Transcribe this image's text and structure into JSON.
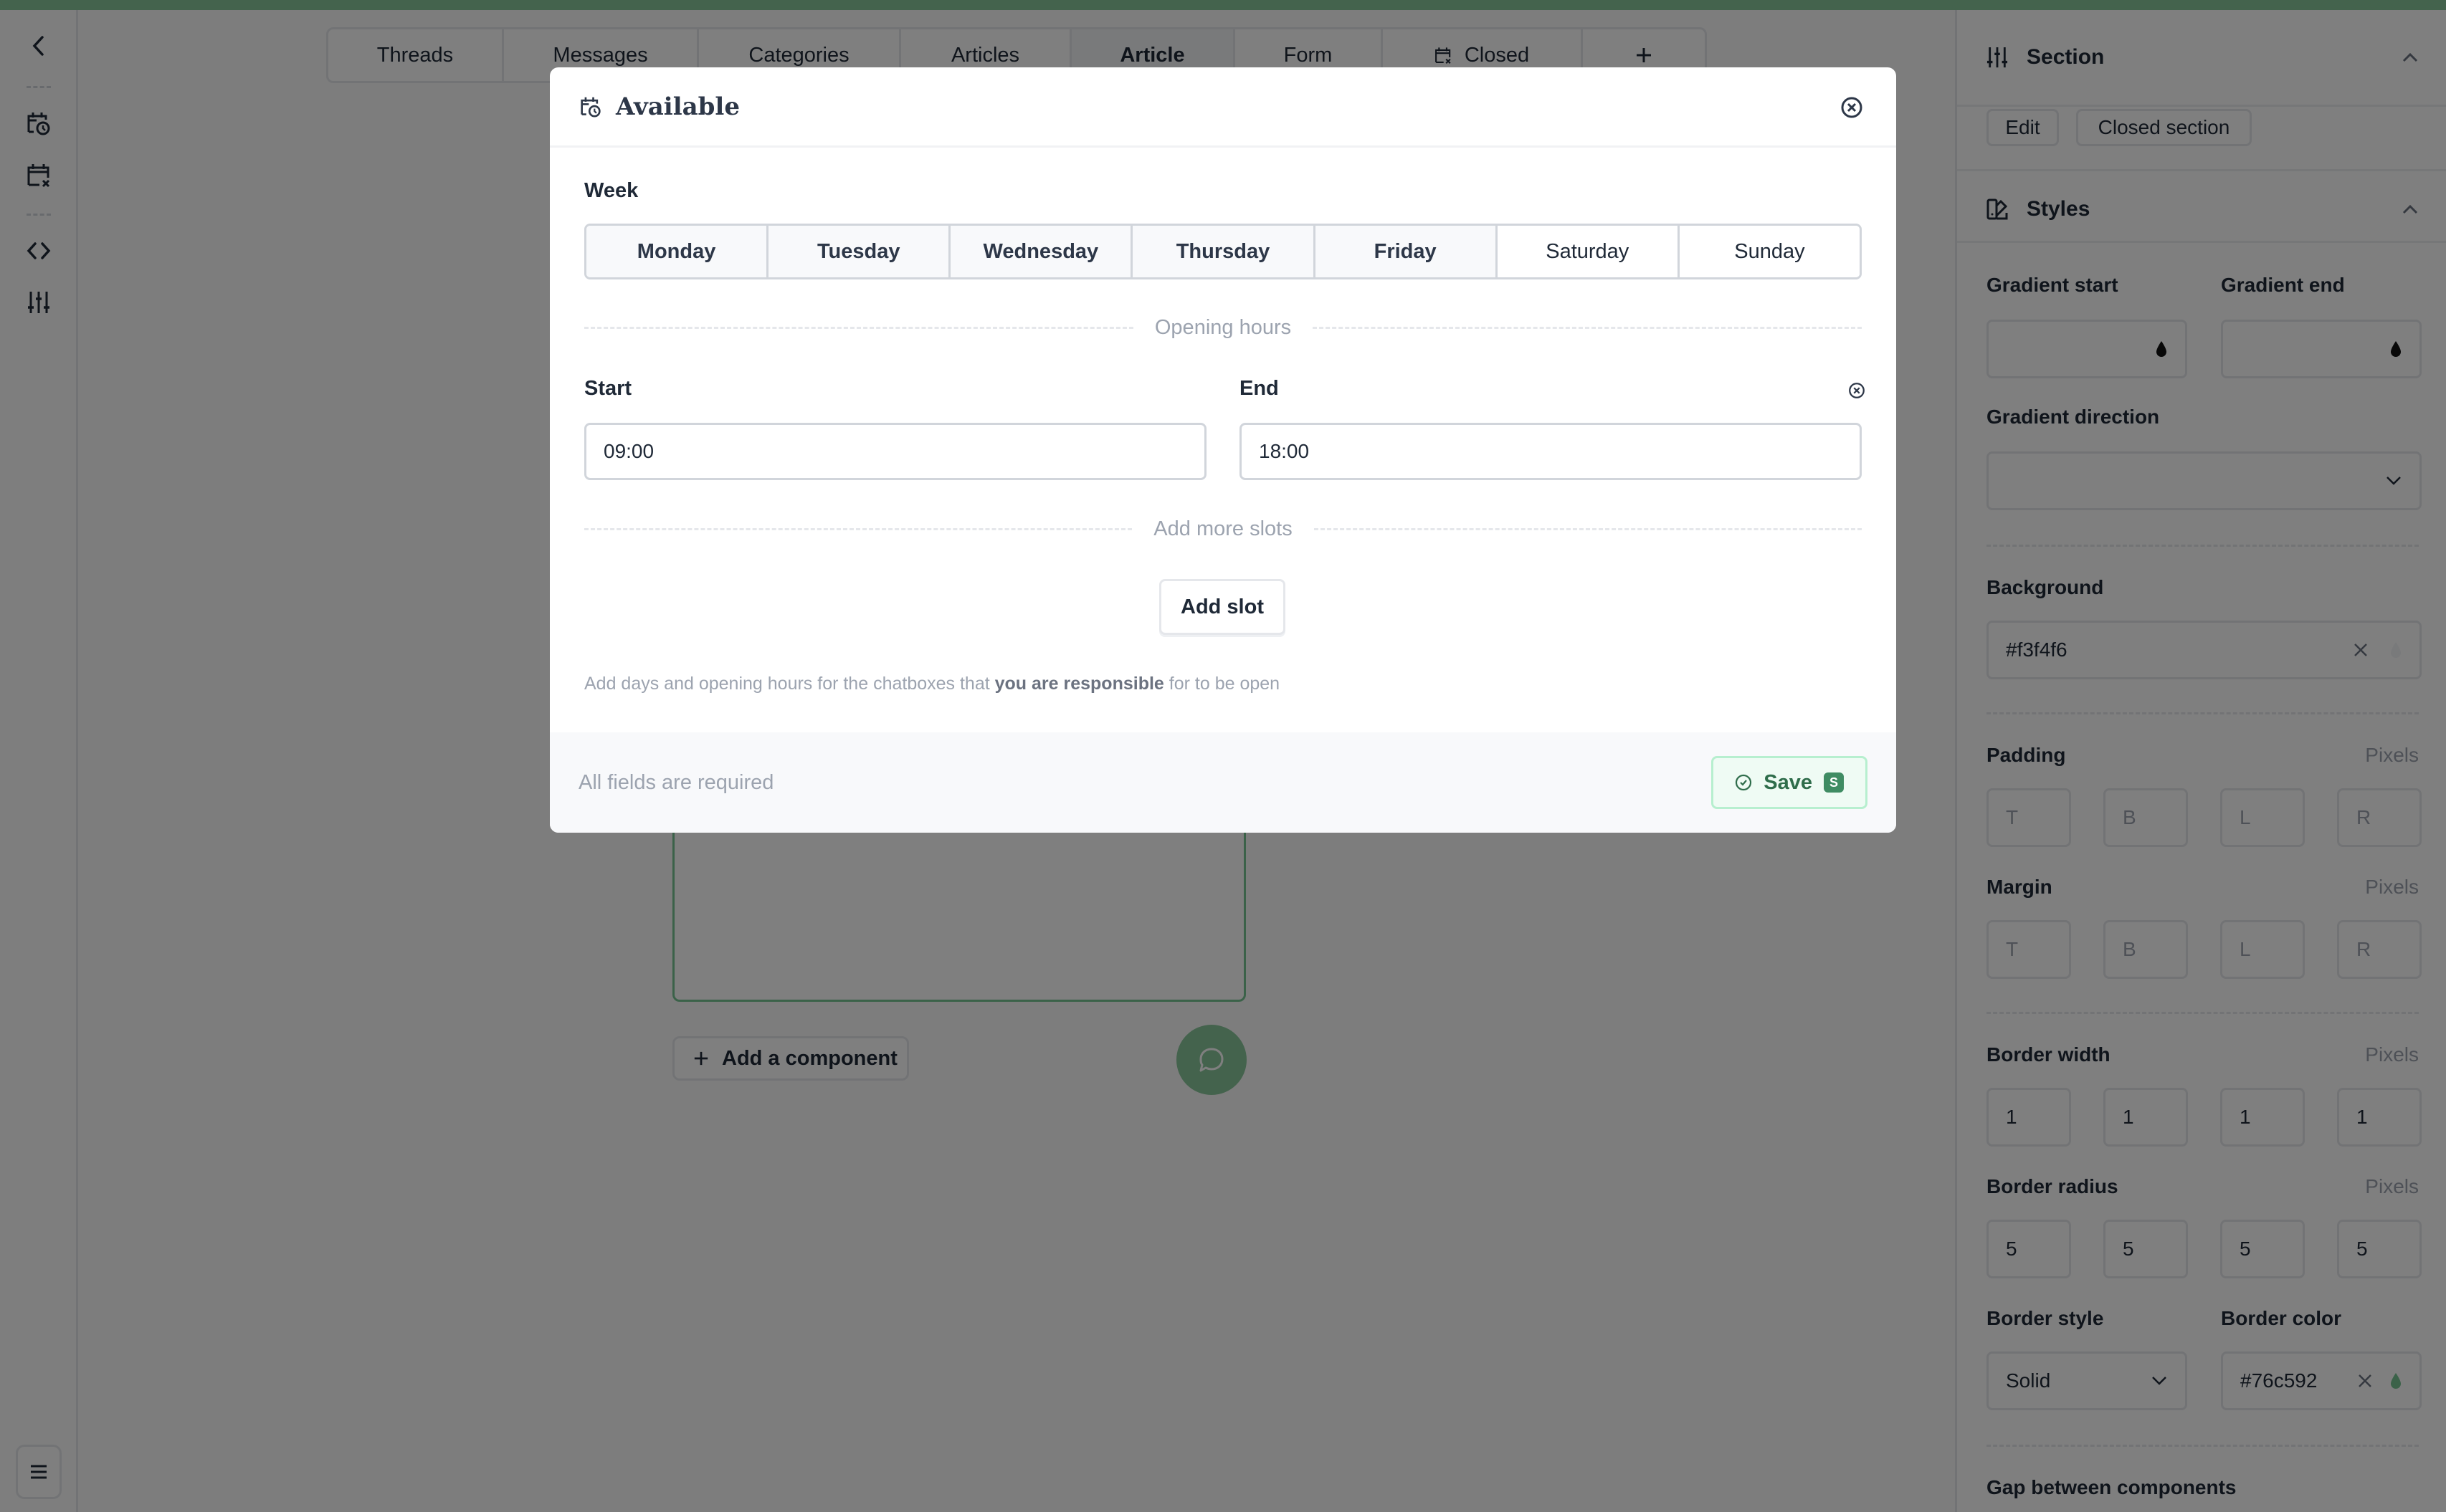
{
  "colors": {
    "brand_green": "#76c592",
    "save_bg": "#effbf4",
    "save_text": "#2f6d4b"
  },
  "rail": {
    "items": [
      {
        "icon": "chevron-left-icon"
      },
      {
        "icon": "calendar-clock-icon"
      },
      {
        "icon": "calendar-x-icon"
      },
      {
        "icon": "code-icon"
      },
      {
        "icon": "sliders-icon"
      }
    ],
    "menu_icon": "hamburger-menu-icon"
  },
  "tabs": [
    {
      "label": "Threads",
      "active": false
    },
    {
      "label": "Messages",
      "active": false
    },
    {
      "label": "Categories",
      "active": false
    },
    {
      "label": "Articles",
      "active": false
    },
    {
      "label": "Article",
      "active": true
    },
    {
      "label": "Form",
      "active": false
    },
    {
      "label": "Closed",
      "active": false,
      "icon": "calendar-x-icon"
    },
    {
      "label": "+",
      "active": false
    }
  ],
  "canvas": {
    "add_component_label": "Add a component"
  },
  "modal": {
    "title": "Available",
    "week_label": "Week",
    "days": [
      {
        "label": "Monday",
        "selected": true
      },
      {
        "label": "Tuesday",
        "selected": true
      },
      {
        "label": "Wednesday",
        "selected": true
      },
      {
        "label": "Thursday",
        "selected": true
      },
      {
        "label": "Friday",
        "selected": true
      },
      {
        "label": "Saturday",
        "selected": false
      },
      {
        "label": "Sunday",
        "selected": false
      }
    ],
    "opening_hours_label": "Opening hours",
    "start_label": "Start",
    "end_label": "End",
    "start_value": "09:00",
    "end_value": "18:00",
    "add_more_slots_label": "Add more slots",
    "add_slot_button": "Add slot",
    "help_prefix": "Add days and opening hours for the chatboxes that ",
    "help_bold": "you are responsible",
    "help_suffix": " for to be open",
    "footer_note": "All fields are required",
    "save_label": "Save",
    "save_shortcut": "S"
  },
  "panel": {
    "section_title": "Section",
    "edit_button": "Edit",
    "closed_section_button": "Closed section",
    "styles_title": "Styles",
    "gradient_start_label": "Gradient start",
    "gradient_end_label": "Gradient end",
    "gradient_start_value": "",
    "gradient_end_value": "",
    "gradient_direction_label": "Gradient direction",
    "gradient_direction_value": "",
    "background_label": "Background",
    "background_value": "#f3f4f6",
    "padding_label": "Padding",
    "margin_label": "Margin",
    "border_width_label": "Border width",
    "border_radius_label": "Border radius",
    "unit_label": "Pixels",
    "padding": [
      {
        "placeholder": "T",
        "value": ""
      },
      {
        "placeholder": "B",
        "value": ""
      },
      {
        "placeholder": "L",
        "value": ""
      },
      {
        "placeholder": "R",
        "value": ""
      }
    ],
    "margin": [
      {
        "placeholder": "T",
        "value": ""
      },
      {
        "placeholder": "B",
        "value": ""
      },
      {
        "placeholder": "L",
        "value": ""
      },
      {
        "placeholder": "R",
        "value": ""
      }
    ],
    "border_width": [
      "1",
      "1",
      "1",
      "1"
    ],
    "border_radius": [
      "5",
      "5",
      "5",
      "5"
    ],
    "border_style_label": "Border style",
    "border_style_value": "Solid",
    "border_color_label": "Border color",
    "border_color_value": "#76c592",
    "gap_label": "Gap between components"
  }
}
